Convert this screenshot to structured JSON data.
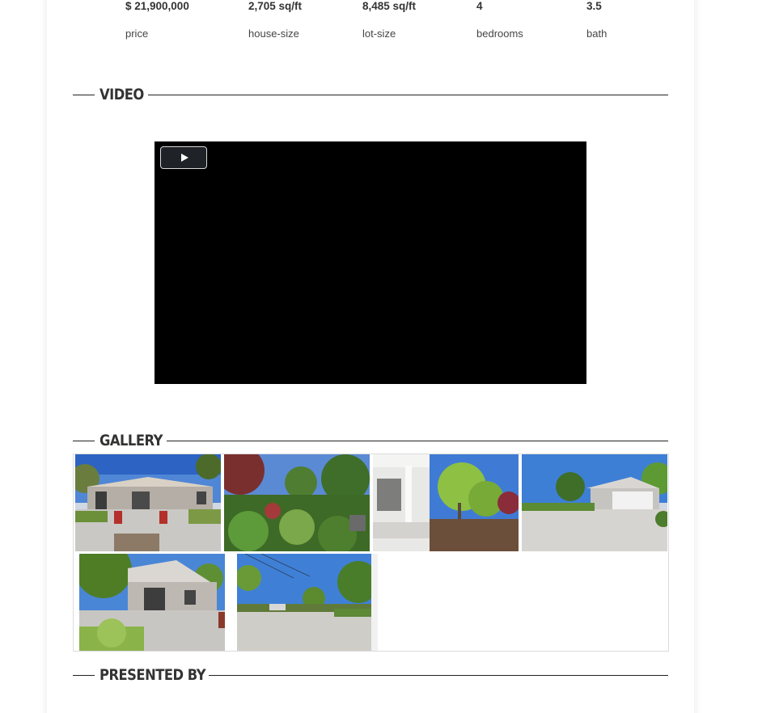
{
  "stats": [
    {
      "value": "$ 21,900,000",
      "label": "price",
      "icon": "dollar-icon"
    },
    {
      "value": "2,705 sq/ft",
      "label": "house-size",
      "icon": "house-size-icon"
    },
    {
      "value": "8,485 sq/ft",
      "label": "lot-size",
      "icon": "lot-size-icon"
    },
    {
      "value": "4",
      "label": "bedrooms",
      "icon": "bed-icon"
    },
    {
      "value": "3.5",
      "label": "bath",
      "icon": "bath-icon"
    }
  ],
  "sections": {
    "video": "VIDEO",
    "gallery": "GALLERY",
    "presented_by": "PRESENTED BY"
  },
  "video": {
    "play_icon": "play-icon"
  },
  "gallery": {
    "photo_count": 6,
    "photos": [
      "backyard-patio",
      "front-garden",
      "covered-porch",
      "driveway-garage",
      "covered-patio",
      "street-view"
    ]
  },
  "colors": {
    "text": "#333333",
    "rule": "#222222",
    "video_bg": "#000000",
    "play_button_bg": "#1f2226"
  }
}
